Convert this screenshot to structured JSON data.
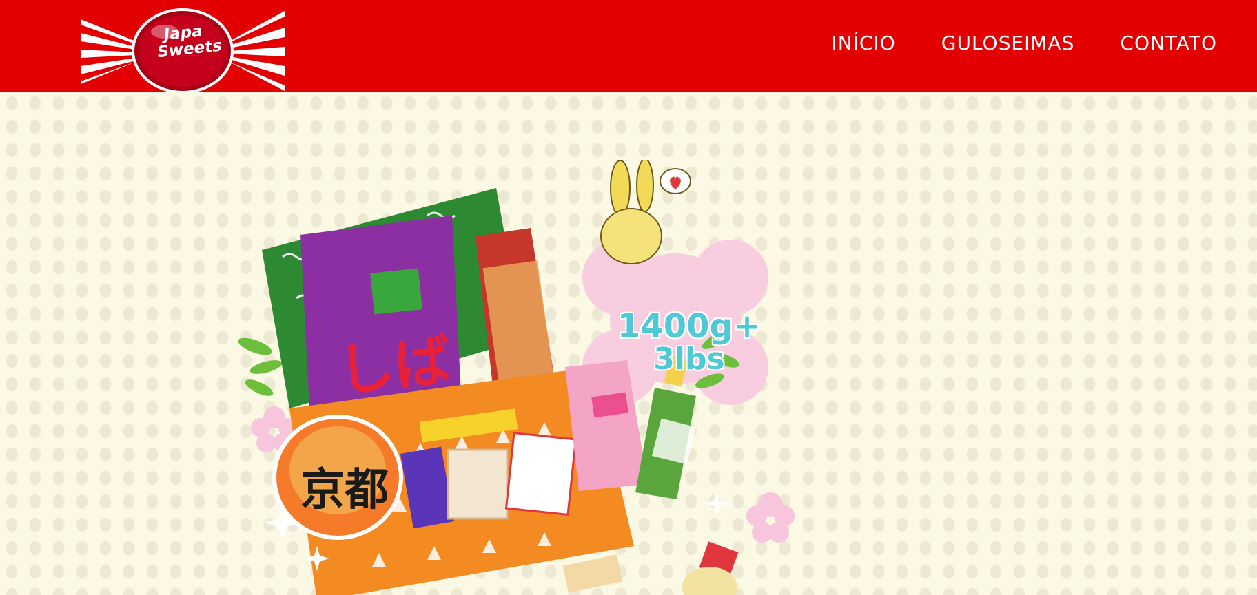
{
  "brand": {
    "line1": "Japa",
    "line2": "Sweets",
    "colors": {
      "primary": "#e30000",
      "wrapper_stripe": "#e30000",
      "candy": "#b8001a"
    }
  },
  "nav": {
    "items": [
      {
        "label": "INÍCIO"
      },
      {
        "label": "GULOSEIMAS"
      },
      {
        "label": "CONTATO"
      }
    ]
  },
  "hero": {
    "badge_weight": "1400g+",
    "badge_lbs": "3lbs",
    "colors": {
      "background": "#fbf8e3",
      "badge_text": "#4fc9d6",
      "petal": "#f7c6dc"
    }
  }
}
